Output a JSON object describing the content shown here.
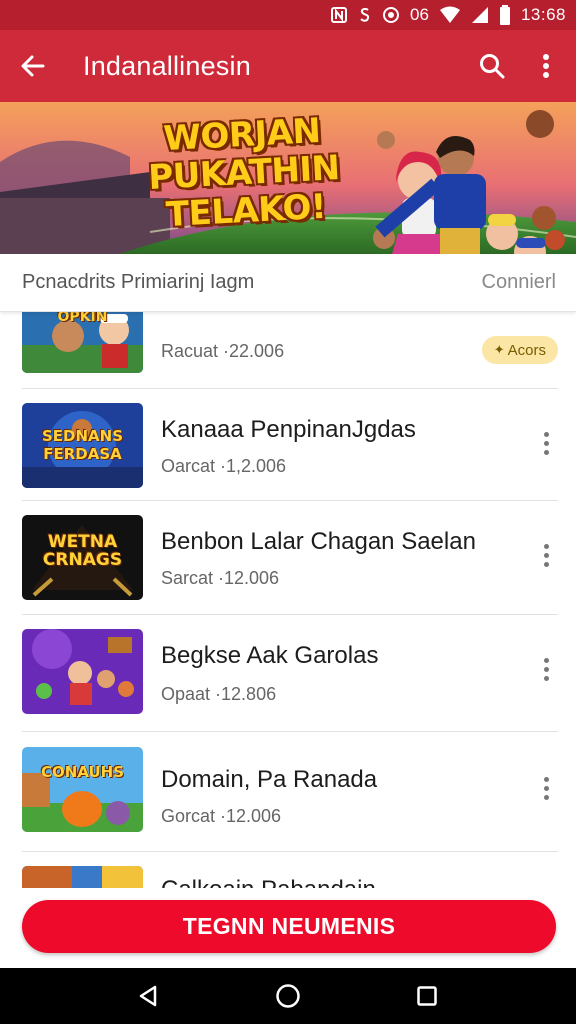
{
  "status_bar": {
    "time": "13:68",
    "battery_text": "06"
  },
  "app_bar": {
    "title": "Indanallinesin"
  },
  "banner": {
    "title_lines": [
      "WORJAN",
      "PUKATHIN",
      "TELAKO!"
    ]
  },
  "section": {
    "title": "Pcnacdrits Primiarinj Iagm",
    "link": "Connierl"
  },
  "items": [
    {
      "thumb_label": "OPKIN",
      "title": "",
      "subtitle": "Racuat ·22.006",
      "badge": "Acors"
    },
    {
      "thumb_label": "SEDNANS FERDASA",
      "title": "Kanaaa PenpinanJgdas",
      "subtitle": "Oarcat ·1,2.006"
    },
    {
      "thumb_label": "WETNA CRNAGS",
      "title": "Benbon Lalar Chagan Saelan",
      "subtitle": "Sarcat ·12.006"
    },
    {
      "thumb_label": "",
      "title": "Begkse Aak Garolas",
      "subtitle": "Opaat ·12.806"
    },
    {
      "thumb_label": "CONAUHS",
      "title": "Domain, Pa Ranada",
      "subtitle": "Gorcat ·12.006"
    },
    {
      "thumb_label": "",
      "title": "Calkoain Pabandain",
      "subtitle": ""
    }
  ],
  "cta": {
    "label": "TEGNN NEUMENIS"
  },
  "icons": {
    "back": "arrow-left-icon",
    "search": "search-icon",
    "more": "more-vertical-icon",
    "nav_back": "triangle-back-icon",
    "nav_home": "circle-home-icon",
    "nav_recents": "square-recents-icon"
  },
  "colors": {
    "status_bar": "#b61f2e",
    "app_bar": "#cf2a3a",
    "cta": "#ee0a2a",
    "badge_bg": "#fbe6a6",
    "nav_bar": "#000000"
  }
}
